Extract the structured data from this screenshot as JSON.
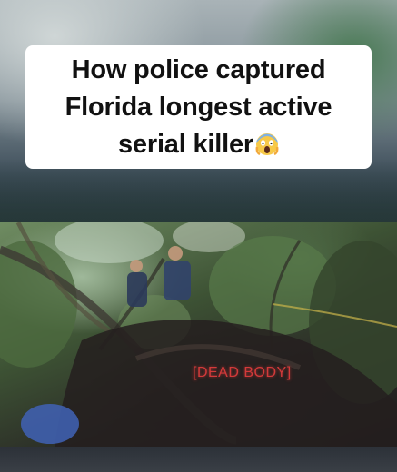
{
  "caption": {
    "line1": "How police captured",
    "line2": "Florida longest active",
    "line3": "serial killer",
    "emoji": "face-screaming-in-fear-icon"
  },
  "video": {
    "overlay_label": "[DEAD BODY]"
  },
  "colors": {
    "caption_bg": "#ffffff",
    "overlay_label": "#d23a3a"
  }
}
